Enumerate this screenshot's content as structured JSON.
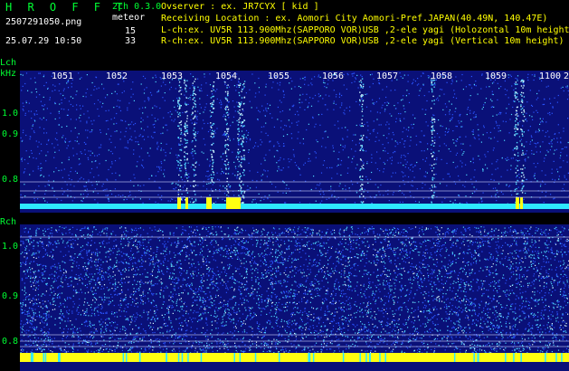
{
  "header": {
    "brand": "H R O F F T",
    "mode": "2ch 0.3.0",
    "meteor_label": "meteor",
    "l_count": "15",
    "r_count": "33",
    "filename": "2507291050.png",
    "datetime": "25.07.29 10:50"
  },
  "info": {
    "observer": "Ovserver            : ex. JR7CYX [ kid ]",
    "location": "Receiving Location : ex. Aomori City Aomori-Pref.JAPAN(40.49N, 140.47E)",
    "lch": "L-ch:ex. UV5R 113.900Mhz(SAPPORO VOR)USB ,2-ele yagi (Holozontal 10m height)",
    "rch": "R-ch:ex. UV5R 113.900Mhz(SAPPORO VOR)USB ,2-ele yagi (Vertical 10m height)"
  },
  "time_axis": {
    "labels": [
      "1051",
      "1052",
      "1053",
      "1054",
      "1055",
      "1056",
      "1057",
      "1058",
      "1059",
      "1100",
      "2"
    ]
  },
  "l_channel": {
    "label": "Lch",
    "unit": "kHz",
    "freq_labels": [
      "1.0",
      "0.9",
      "0.8"
    ]
  },
  "r_channel": {
    "label": "Rch",
    "freq_labels": [
      "1.0",
      "0.9",
      "0.8"
    ]
  },
  "colors": {
    "spectrum_bg": "#0a1078",
    "noise_blue": "#2b55ff",
    "noise_cyan": "#4fd7ff",
    "baseline_cyan": "#2ee8ff",
    "baseline_yellow": "#ffff10",
    "text_green": "#00ff33",
    "text_yellow": "#ffff00",
    "text_white": "#ffffff"
  }
}
